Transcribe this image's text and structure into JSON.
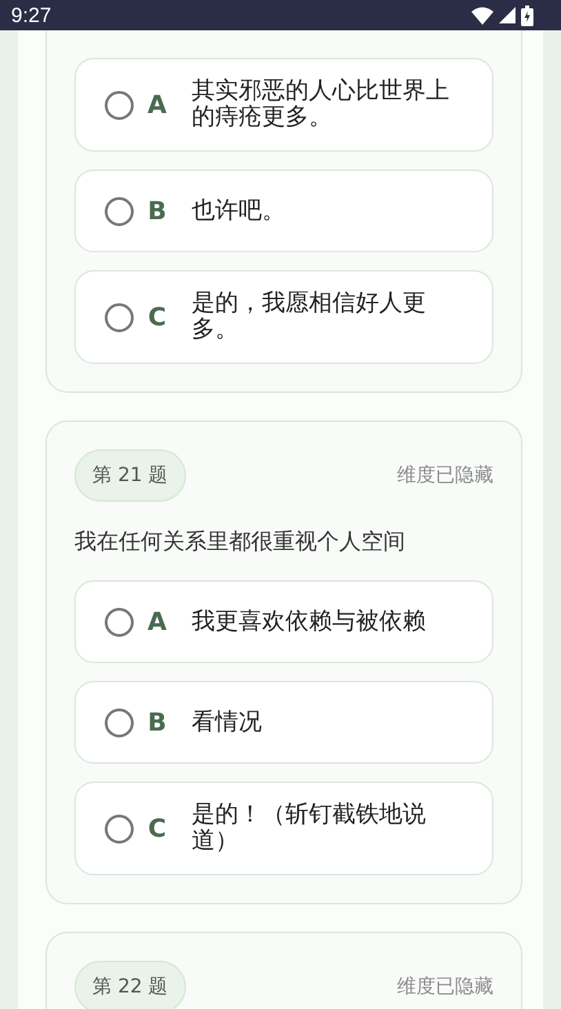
{
  "status_bar": {
    "time": "9:27"
  },
  "questions": [
    {
      "options": [
        {
          "letter": "A",
          "text": "其实邪恶的人心比世界上的痔疮更多。",
          "selected": false
        },
        {
          "letter": "B",
          "text": "也许吧。",
          "selected": false
        },
        {
          "letter": "C",
          "text": "是的，我愿相信好人更多。",
          "selected": false
        }
      ]
    },
    {
      "number": "第 21 题",
      "dimension": "维度已隐藏",
      "text": "我在任何关系里都很重视个人空间",
      "options": [
        {
          "letter": "A",
          "text": "我更喜欢依赖与被依赖",
          "selected": false
        },
        {
          "letter": "B",
          "text": "看情况",
          "selected": false
        },
        {
          "letter": "C",
          "text": "是的！（斩钉截铁地说道）",
          "selected": false
        }
      ]
    },
    {
      "number": "第 22 题",
      "dimension": "维度已隐藏"
    }
  ]
}
